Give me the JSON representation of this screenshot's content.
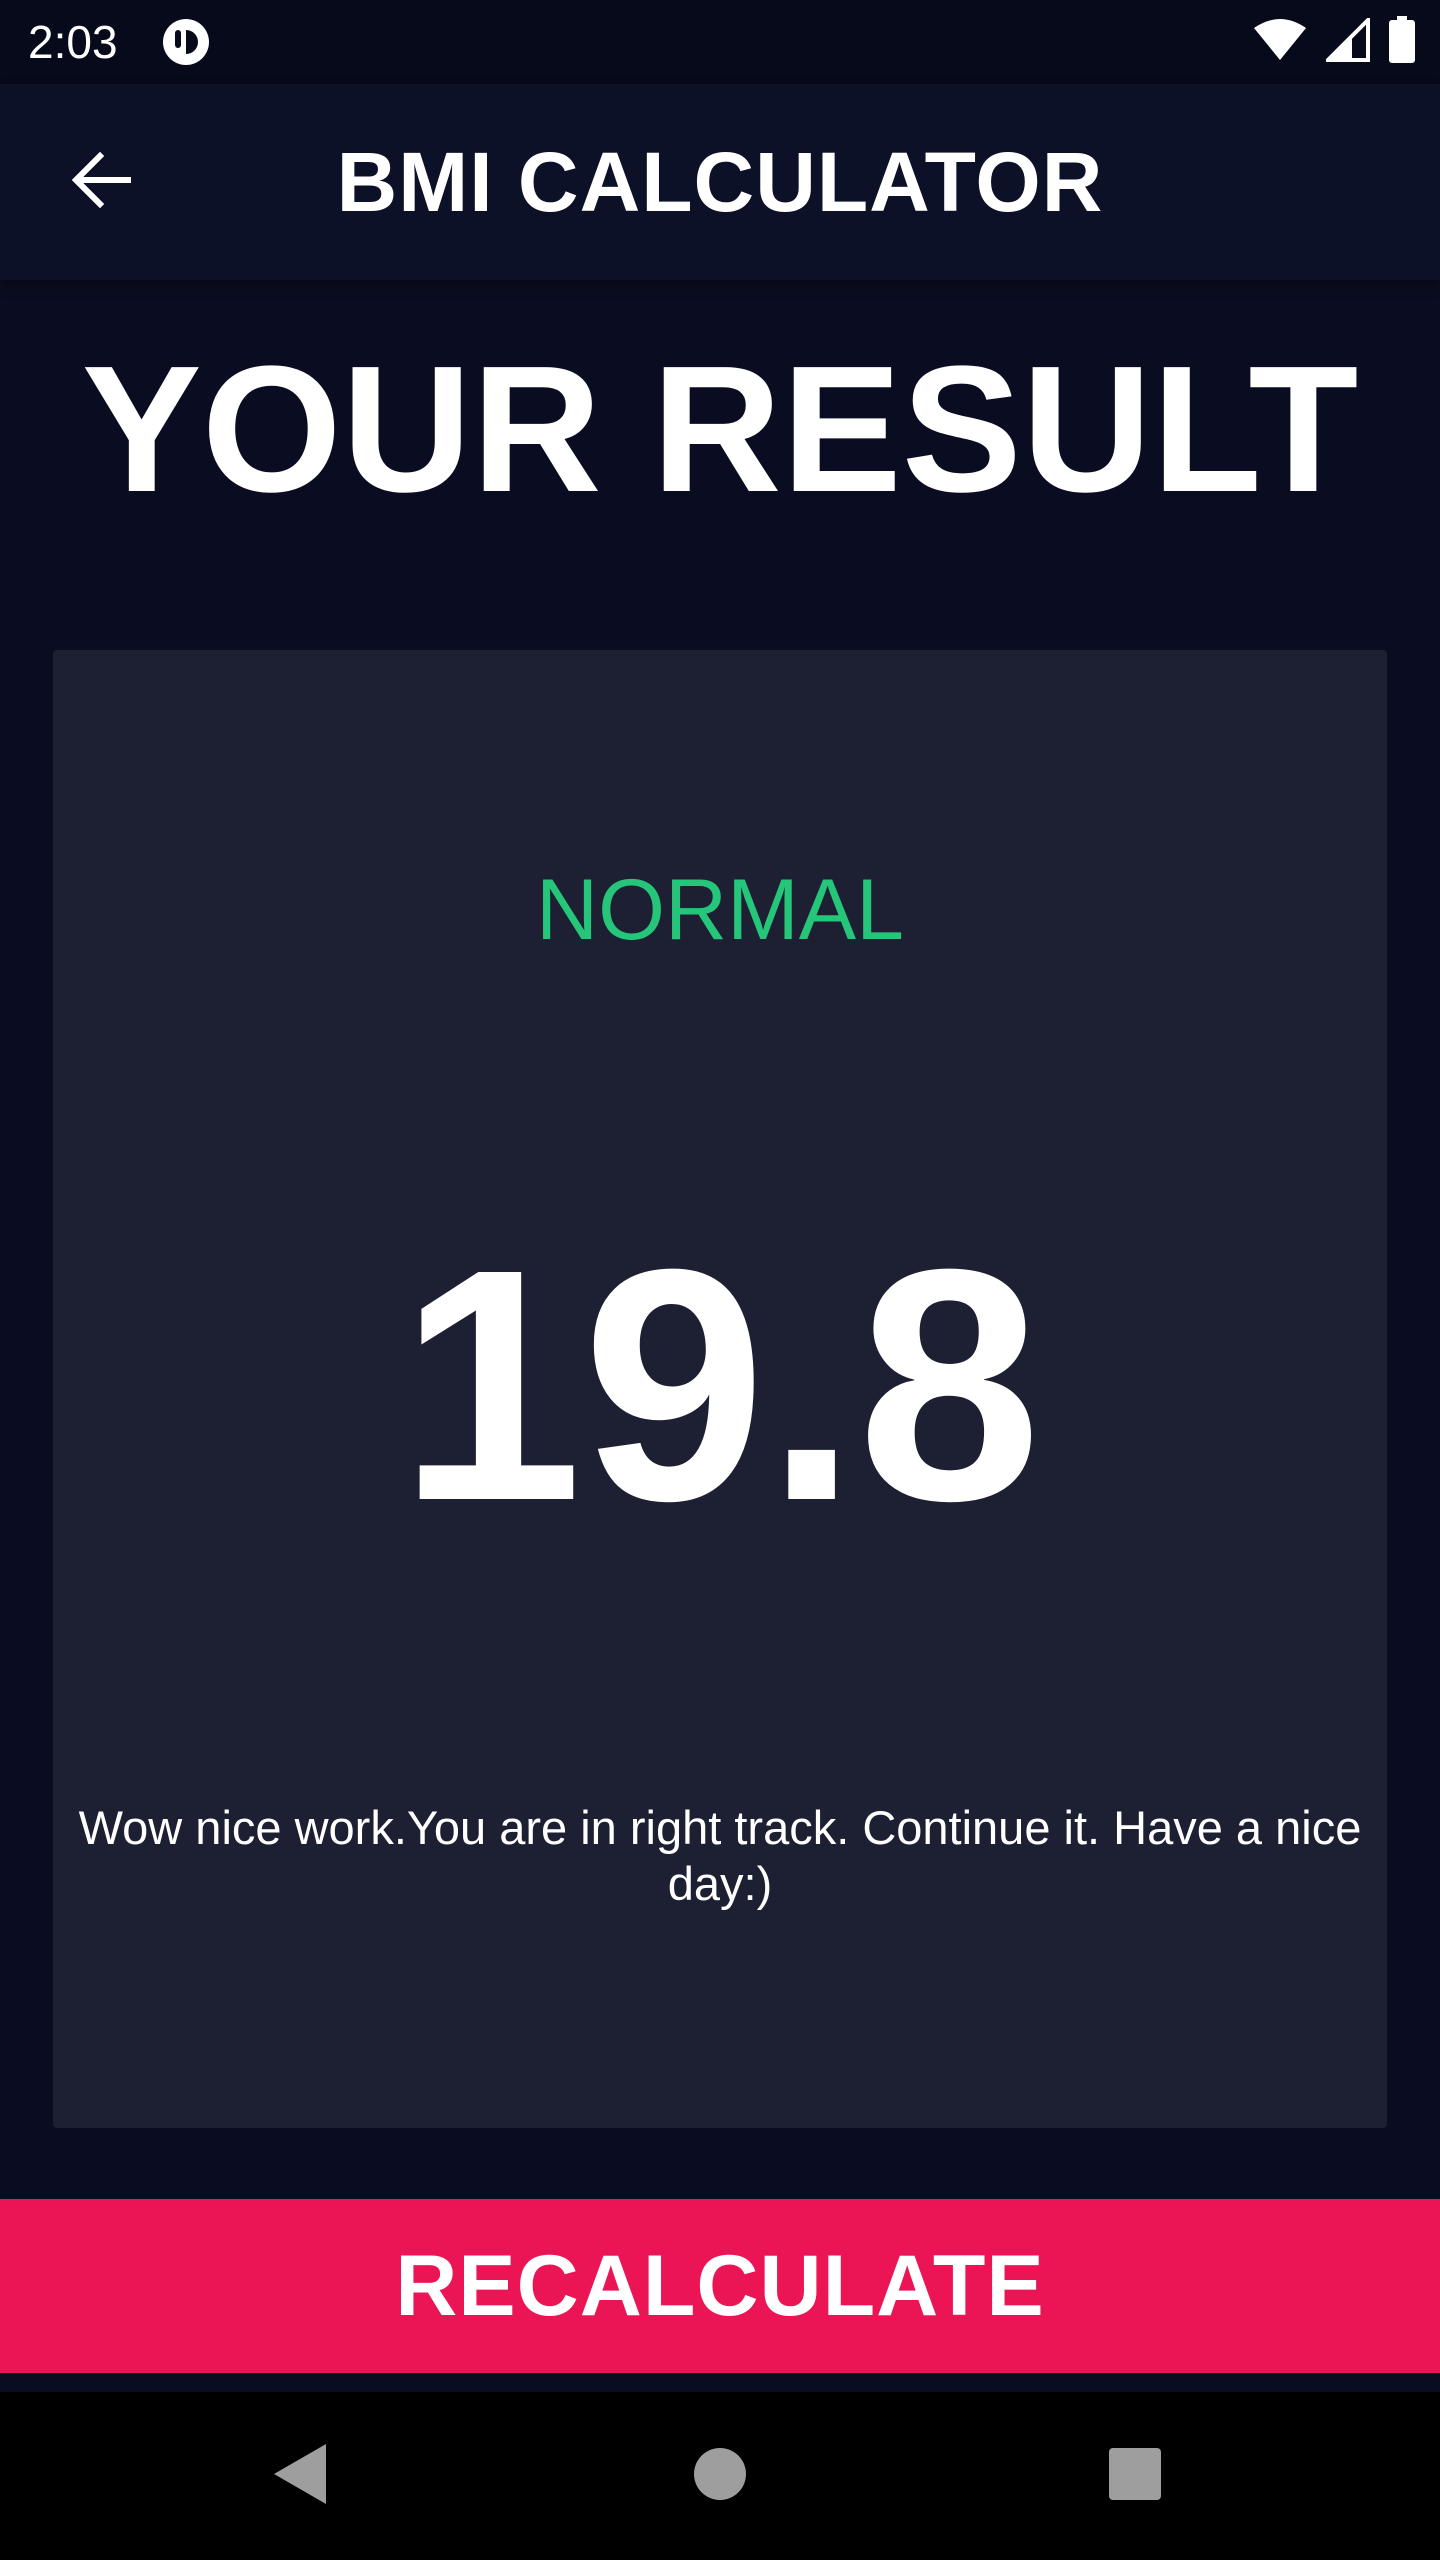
{
  "status_bar": {
    "time": "2:03",
    "app_icon": "notification-app-icon",
    "icons": [
      "wifi-icon",
      "cell-signal-icon",
      "battery-icon"
    ]
  },
  "app_bar": {
    "title": "BMI CALCULATOR",
    "back_icon": "arrow-back-icon"
  },
  "main": {
    "heading": "YOUR RESULT",
    "result": {
      "status": "NORMAL",
      "bmi": "19.8",
      "message": "Wow nice work.You are in right track. Continue it. Have a nice day:)"
    }
  },
  "action": {
    "label": "RECALCULATE"
  },
  "navigation_bar": {
    "icons": [
      "nav-back-icon",
      "nav-home-icon",
      "nav-recents-icon"
    ]
  },
  "colors": {
    "background": "#0a0d22",
    "card": "#1d1f33",
    "status_normal": "#26c67a",
    "accent": "#eb1555"
  }
}
